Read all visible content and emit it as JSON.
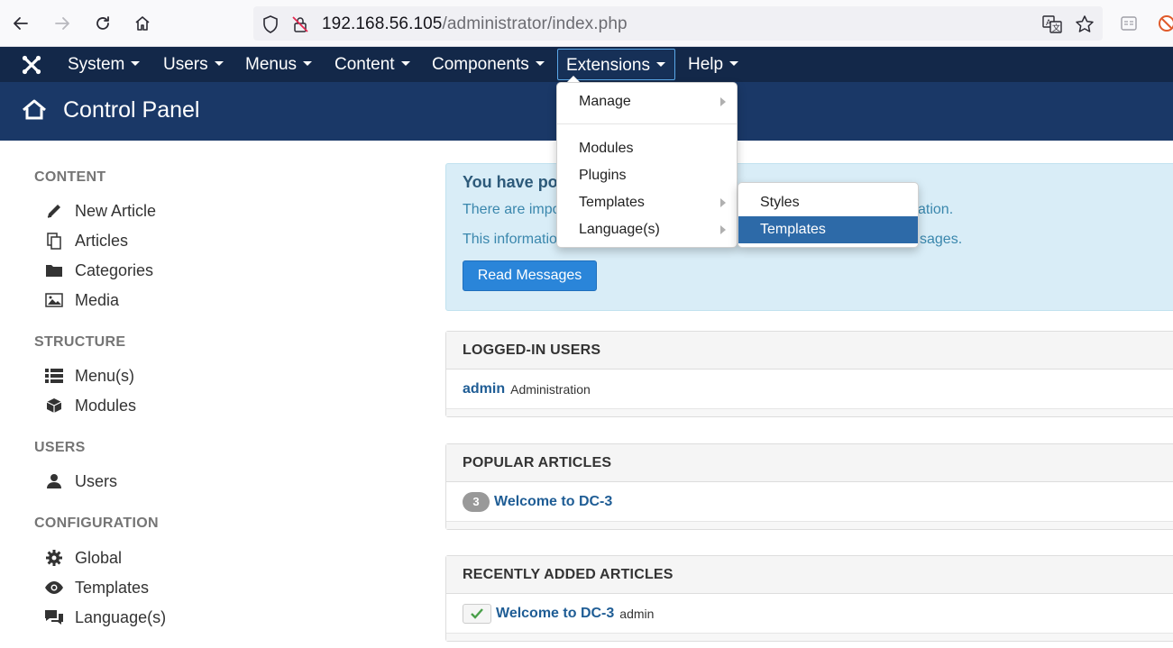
{
  "browser": {
    "url_host": "192.168.56.105",
    "url_path": "/administrator/index.php"
  },
  "topnav": {
    "items": [
      {
        "label": "System"
      },
      {
        "label": "Users"
      },
      {
        "label": "Menus"
      },
      {
        "label": "Content"
      },
      {
        "label": "Components"
      },
      {
        "label": "Extensions"
      },
      {
        "label": "Help"
      }
    ]
  },
  "header": {
    "title": "Control Panel"
  },
  "extensions_menu": {
    "manage": "Manage",
    "modules": "Modules",
    "plugins": "Plugins",
    "templates": "Templates",
    "languages": "Language(s)"
  },
  "templates_submenu": {
    "styles": "Styles",
    "templates": "Templates"
  },
  "sidebar": {
    "content_heading": "CONTENT",
    "new_article": "New Article",
    "articles": "Articles",
    "categories": "Categories",
    "media": "Media",
    "structure_heading": "STRUCTURE",
    "menus": "Menu(s)",
    "modules": "Modules",
    "users_heading": "USERS",
    "users": "Users",
    "configuration_heading": "CONFIGURATION",
    "global": "Global",
    "templates": "Templates",
    "languages": "Language(s)"
  },
  "alert": {
    "title_visible": "You have pos",
    "line1_start": "There are impo",
    "line1_end": "ation.",
    "line2_start": "This informatio",
    "line2_end": "sages.",
    "button": "Read Messages"
  },
  "logged_in": {
    "heading": "LOGGED-IN USERS",
    "user": "admin",
    "role": "Administration"
  },
  "popular": {
    "heading": "POPULAR ARTICLES",
    "hits": "3",
    "title": "Welcome to DC-3"
  },
  "recent": {
    "heading": "RECENTLY ADDED ARTICLES",
    "title": "Welcome to DC-3",
    "author": "admin"
  },
  "colors": {
    "topnav": "#132849",
    "header": "#1a3867",
    "accent": "#2a85d9",
    "highlight": "#2d6aa8"
  }
}
